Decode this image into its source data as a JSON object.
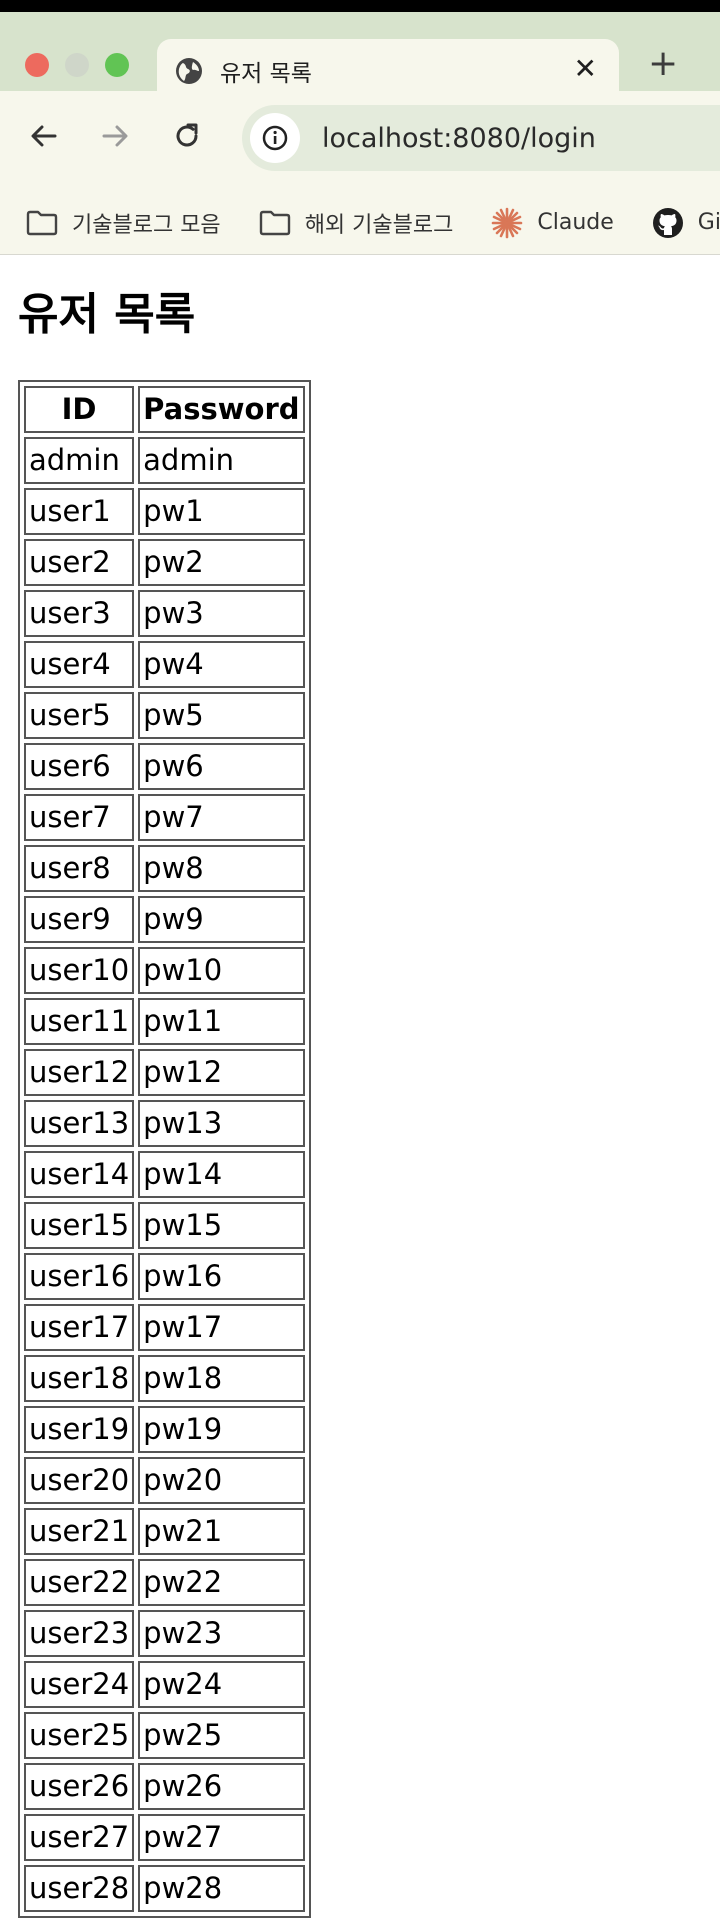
{
  "browser": {
    "tab_title": "유저 목록",
    "close_glyph": "✕",
    "newtab_glyph": "+",
    "url": "localhost:8080/login",
    "bookmarks": [
      {
        "label": "기술블로그 모음",
        "icon": "folder-icon"
      },
      {
        "label": "해외 기술블로그",
        "icon": "folder-icon"
      },
      {
        "label": "Claude",
        "icon": "claude-icon"
      },
      {
        "label": "Gi",
        "icon": "github-icon"
      }
    ]
  },
  "page": {
    "title": "유저 목록",
    "table": {
      "headers": [
        "ID",
        "Password"
      ],
      "rows": [
        [
          "admin",
          "admin"
        ],
        [
          "user1",
          "pw1"
        ],
        [
          "user2",
          "pw2"
        ],
        [
          "user3",
          "pw3"
        ],
        [
          "user4",
          "pw4"
        ],
        [
          "user5",
          "pw5"
        ],
        [
          "user6",
          "pw6"
        ],
        [
          "user7",
          "pw7"
        ],
        [
          "user8",
          "pw8"
        ],
        [
          "user9",
          "pw9"
        ],
        [
          "user10",
          "pw10"
        ],
        [
          "user11",
          "pw11"
        ],
        [
          "user12",
          "pw12"
        ],
        [
          "user13",
          "pw13"
        ],
        [
          "user14",
          "pw14"
        ],
        [
          "user15",
          "pw15"
        ],
        [
          "user16",
          "pw16"
        ],
        [
          "user17",
          "pw17"
        ],
        [
          "user18",
          "pw18"
        ],
        [
          "user19",
          "pw19"
        ],
        [
          "user20",
          "pw20"
        ],
        [
          "user21",
          "pw21"
        ],
        [
          "user22",
          "pw22"
        ],
        [
          "user23",
          "pw23"
        ],
        [
          "user24",
          "pw24"
        ],
        [
          "user25",
          "pw25"
        ],
        [
          "user26",
          "pw26"
        ],
        [
          "user27",
          "pw27"
        ],
        [
          "user28",
          "pw28"
        ]
      ]
    }
  },
  "colors": {
    "tabstrip": "#d7e3cc",
    "toolbar": "#f7f7ec",
    "omnibox": "#e4ebdc",
    "claude_accent": "#d97757"
  }
}
